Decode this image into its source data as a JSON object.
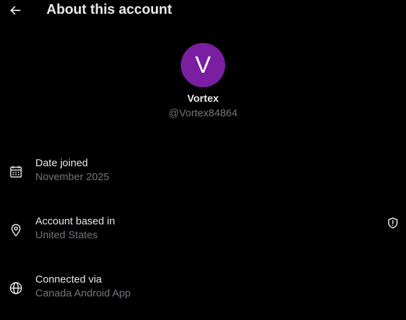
{
  "header": {
    "title": "About this account",
    "back_icon": "arrow-left-icon"
  },
  "profile": {
    "avatar_letter": "V",
    "avatar_color": "#7b1fa2",
    "display_name": "Vortex",
    "handle": "@Vortex84864"
  },
  "details": [
    {
      "icon": "calendar-icon",
      "label": "Date joined",
      "value": "November 2025"
    },
    {
      "icon": "location-pin-icon",
      "label": "Account based in",
      "value": "United States",
      "action_icon": "shield-alert-icon"
    },
    {
      "icon": "globe-icon",
      "label": "Connected via",
      "value": "Canada Android App"
    }
  ],
  "colors": {
    "background": "#000000",
    "primary_text": "#e7e9ea",
    "secondary_text": "#71767b"
  }
}
